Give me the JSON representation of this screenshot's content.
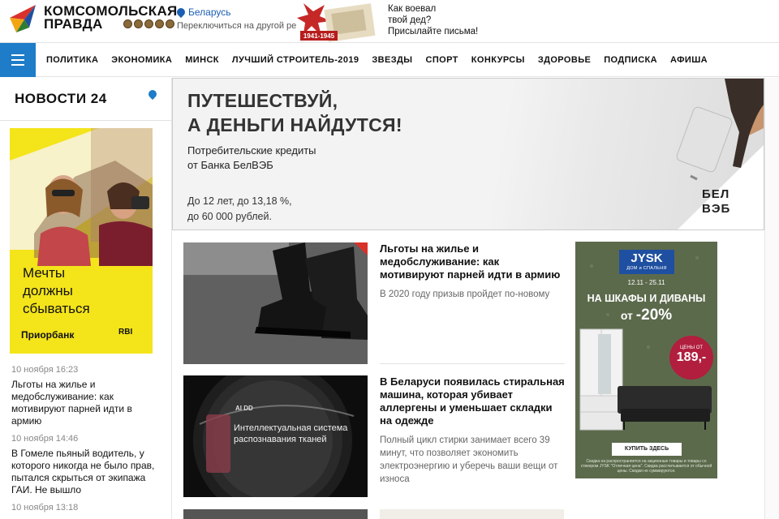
{
  "header": {
    "logo_line1": "КОМСОМОЛЬСКАЯ",
    "logo_line2": "ПРАВДА",
    "region_name": "Беларусь",
    "region_switch": "Переключиться на другой регион",
    "promo_years": "1941-1945",
    "promo_line1": "Как воевал",
    "promo_line2": "твой дед?",
    "promo_line3": "Присылайте письма!"
  },
  "nav": {
    "items": [
      "ПОЛИТИКА",
      "ЭКОНОМИКА",
      "МИНСК",
      "ЛУЧШИЙ СТРОИТЕЛЬ-2019",
      "ЗВЕЗДЫ",
      "СПОРТ",
      "КОНКУРСЫ",
      "ЗДОРОВЬЕ",
      "ПОДПИСКА",
      "АФИША"
    ]
  },
  "sidebar": {
    "title": "НОВОСТИ 24",
    "ad": {
      "line1": "Мечты",
      "line2": "должны",
      "line3": "сбываться",
      "brand": "Приорбанк",
      "brand2": "RBI"
    },
    "news": [
      {
        "time": "10 ноября 16:23",
        "title": "Льготы на жилье и медобслуживание: как мотивируют парней идти в армию"
      },
      {
        "time": "10 ноября 14:46",
        "title": "В Гомеле пьяный водитель, у которого никогда не было прав, пытался скрыться от экипажа ГАИ. Не вышло"
      },
      {
        "time": "10 ноября 13:18",
        "title": ""
      }
    ]
  },
  "banner": {
    "title_line1": "ПУТЕШЕСТВУЙ,",
    "title_line2": "А ДЕНЬГИ НАЙДУТСЯ!",
    "sub_line1": "Потребительские кредиты",
    "sub_line2": "от Банка БелВЭБ",
    "terms_line1": "До 12 лет, до 13,18 %,",
    "terms_line2": "до 60 000 рублей.",
    "logo_line1": "БЕЛ",
    "logo_line2": "ВЭБ"
  },
  "articles": [
    {
      "title": "Льготы на жилье и медобслуживание: как мотивируют парней идти в армию",
      "desc": "В 2020 году призыв пройдет по-новому"
    },
    {
      "title": "В Беларуси появилась стиральная машина, которая убивает аллергены и уменьшает складки на одежде",
      "desc": "Полный цикл стирки занимает всего 39 минут, что позволяет экономить электроэнергию и уберечь ваши вещи от износа",
      "img_caption1": "Интеллектуальная система",
      "img_caption2": "распознавания тканей",
      "img_badge": "AI DD"
    }
  ],
  "jysk_ad": {
    "logo": "JYSK",
    "logo_sub": "ДОМ и СПАЛЬНЯ",
    "dates": "12.11 - 25.11",
    "headline": "НА ШКАФЫ И ДИВАНЫ",
    "discount_prefix": "от",
    "discount": "-20%",
    "price_label": "ЦЕНЫ ОТ",
    "price": "189,-",
    "button": "КУПИТЬ ЗДЕСЬ",
    "fine_print": "Скидка на распространяется на акционные товары и товары со стикером JYSK \"Отличная цена\". Скидка рассчитывается от обычной цены. Скидки не суммируются."
  }
}
